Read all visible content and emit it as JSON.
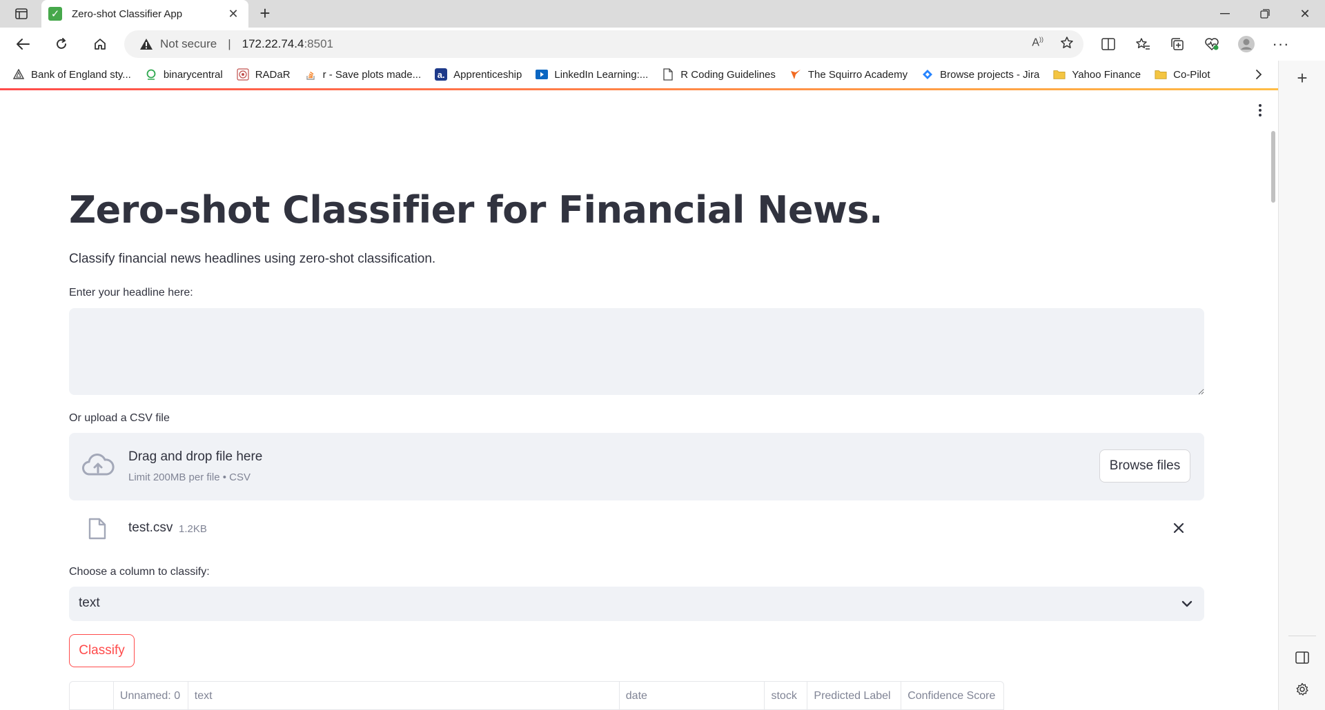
{
  "browser": {
    "tab_title": "Zero-shot Classifier App",
    "address": {
      "security_label": "Not secure",
      "host": "172.22.74.4",
      "port": ":8501"
    },
    "bookmarks": [
      {
        "label": "Bank of England sty...",
        "icon": "triangle-icon"
      },
      {
        "label": "binarycentral",
        "icon": "circle-icon"
      },
      {
        "label": "RADaR",
        "icon": "radar-icon"
      },
      {
        "label": "r - Save plots made...",
        "icon": "stackoverflow-icon"
      },
      {
        "label": "Apprenticeship",
        "icon": "apprenticeship-icon"
      },
      {
        "label": "LinkedIn Learning:...",
        "icon": "linkedin-learning-icon"
      },
      {
        "label": "R Coding Guidelines",
        "icon": "document-icon"
      },
      {
        "label": "The Squirro Academy",
        "icon": "squirro-icon"
      },
      {
        "label": "Browse projects - Jira",
        "icon": "jira-icon"
      },
      {
        "label": "Yahoo Finance",
        "icon": "folder-icon"
      },
      {
        "label": "Co-Pilot",
        "icon": "folder-icon"
      }
    ]
  },
  "app": {
    "title": "Zero-shot Classifier for Financial News.",
    "description": "Classify financial news headlines using zero-shot classification.",
    "headline_label": "Enter your headline here:",
    "headline_value": "",
    "upload_label": "Or upload a CSV file",
    "dropzone_title": "Drag and drop file here",
    "dropzone_limit": "Limit 200MB per file • CSV",
    "browse_label": "Browse files",
    "uploaded_file": {
      "name": "test.csv",
      "size": "1.2KB"
    },
    "column_label": "Choose a column to classify:",
    "column_value": "text",
    "classify_label": "Classify",
    "table_headers": [
      "",
      "Unnamed: 0",
      "text",
      "date",
      "stock",
      "Predicted Label",
      "Confidence Score"
    ]
  },
  "colors": {
    "accent": "#ff4b4b",
    "input_bg": "#f0f2f6",
    "text": "#31333f",
    "muted": "#808495"
  }
}
